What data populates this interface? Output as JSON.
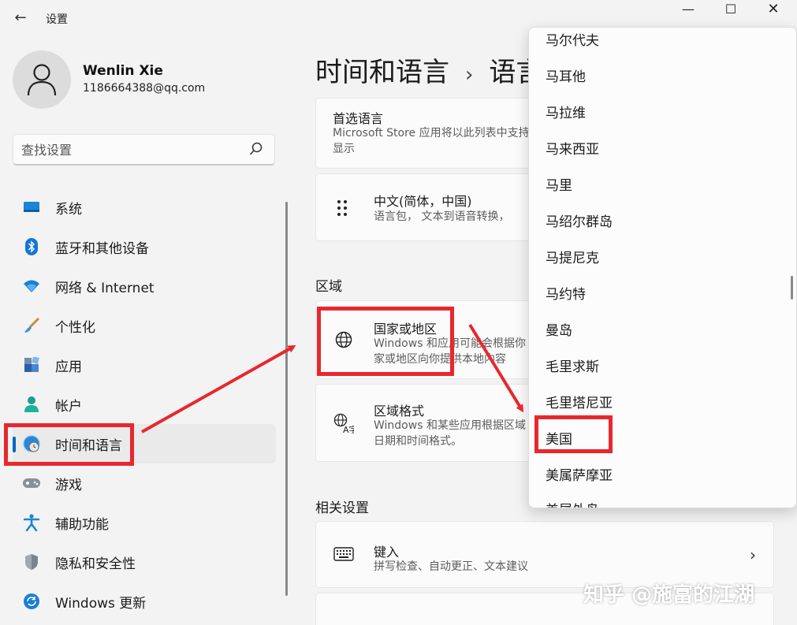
{
  "window": {
    "title": "设置"
  },
  "user": {
    "name": "Wenlin Xie",
    "email": "1186664388@qq.com"
  },
  "search": {
    "placeholder": "查找设置"
  },
  "sidebar": {
    "items": [
      {
        "label": "系统",
        "icon": "system-icon"
      },
      {
        "label": "蓝牙和其他设备",
        "icon": "bluetooth-icon"
      },
      {
        "label": "网络 & Internet",
        "icon": "wifi-icon"
      },
      {
        "label": "个性化",
        "icon": "brush-icon"
      },
      {
        "label": "应用",
        "icon": "apps-icon"
      },
      {
        "label": "帐户",
        "icon": "account-icon"
      },
      {
        "label": "时间和语言",
        "icon": "globe-clock-icon",
        "active": true
      },
      {
        "label": "游戏",
        "icon": "gamepad-icon"
      },
      {
        "label": "辅助功能",
        "icon": "accessibility-icon"
      },
      {
        "label": "隐私和安全性",
        "icon": "shield-icon"
      },
      {
        "label": "Windows 更新",
        "icon": "update-icon"
      }
    ]
  },
  "breadcrumb": {
    "parent": "时间和语言",
    "separator": "›",
    "current": "语言"
  },
  "preferred": {
    "title": "首选语言",
    "desc_line1": "Microsoft Store 应用将以此列表中支持",
    "desc_line2": "显示"
  },
  "language_card": {
    "title": "中文(简体，中国)",
    "desc": "语言包， 文本到语音转换， "
  },
  "region": {
    "heading": "区域",
    "country": {
      "title": "国家或地区",
      "desc_line1": "Windows 和应用可能会根据你",
      "desc_line2": "家或地区向你提供本地内容"
    },
    "format": {
      "title": "区域格式",
      "desc_line1": "Windows 和某些应用根据区域",
      "desc_line2": "日期和时间格式。"
    }
  },
  "related": {
    "heading": "相关设置",
    "typing": {
      "title": "键入",
      "desc": "拼写检查、自动更正、文本建议"
    }
  },
  "dropdown": {
    "items": [
      "马尔代夫",
      "马耳他",
      "马拉维",
      "马来西亚",
      "马里",
      "马绍尔群岛",
      "马提尼克",
      "马约特",
      "曼岛",
      "毛里求斯",
      "毛里塔尼亚",
      "美国",
      "美属萨摩亚",
      "美属外岛"
    ],
    "selected": "美国"
  },
  "watermark": "知乎 @施富的江湖",
  "colors": {
    "accent": "#0067c0",
    "annotation_red": "#e8272e"
  }
}
